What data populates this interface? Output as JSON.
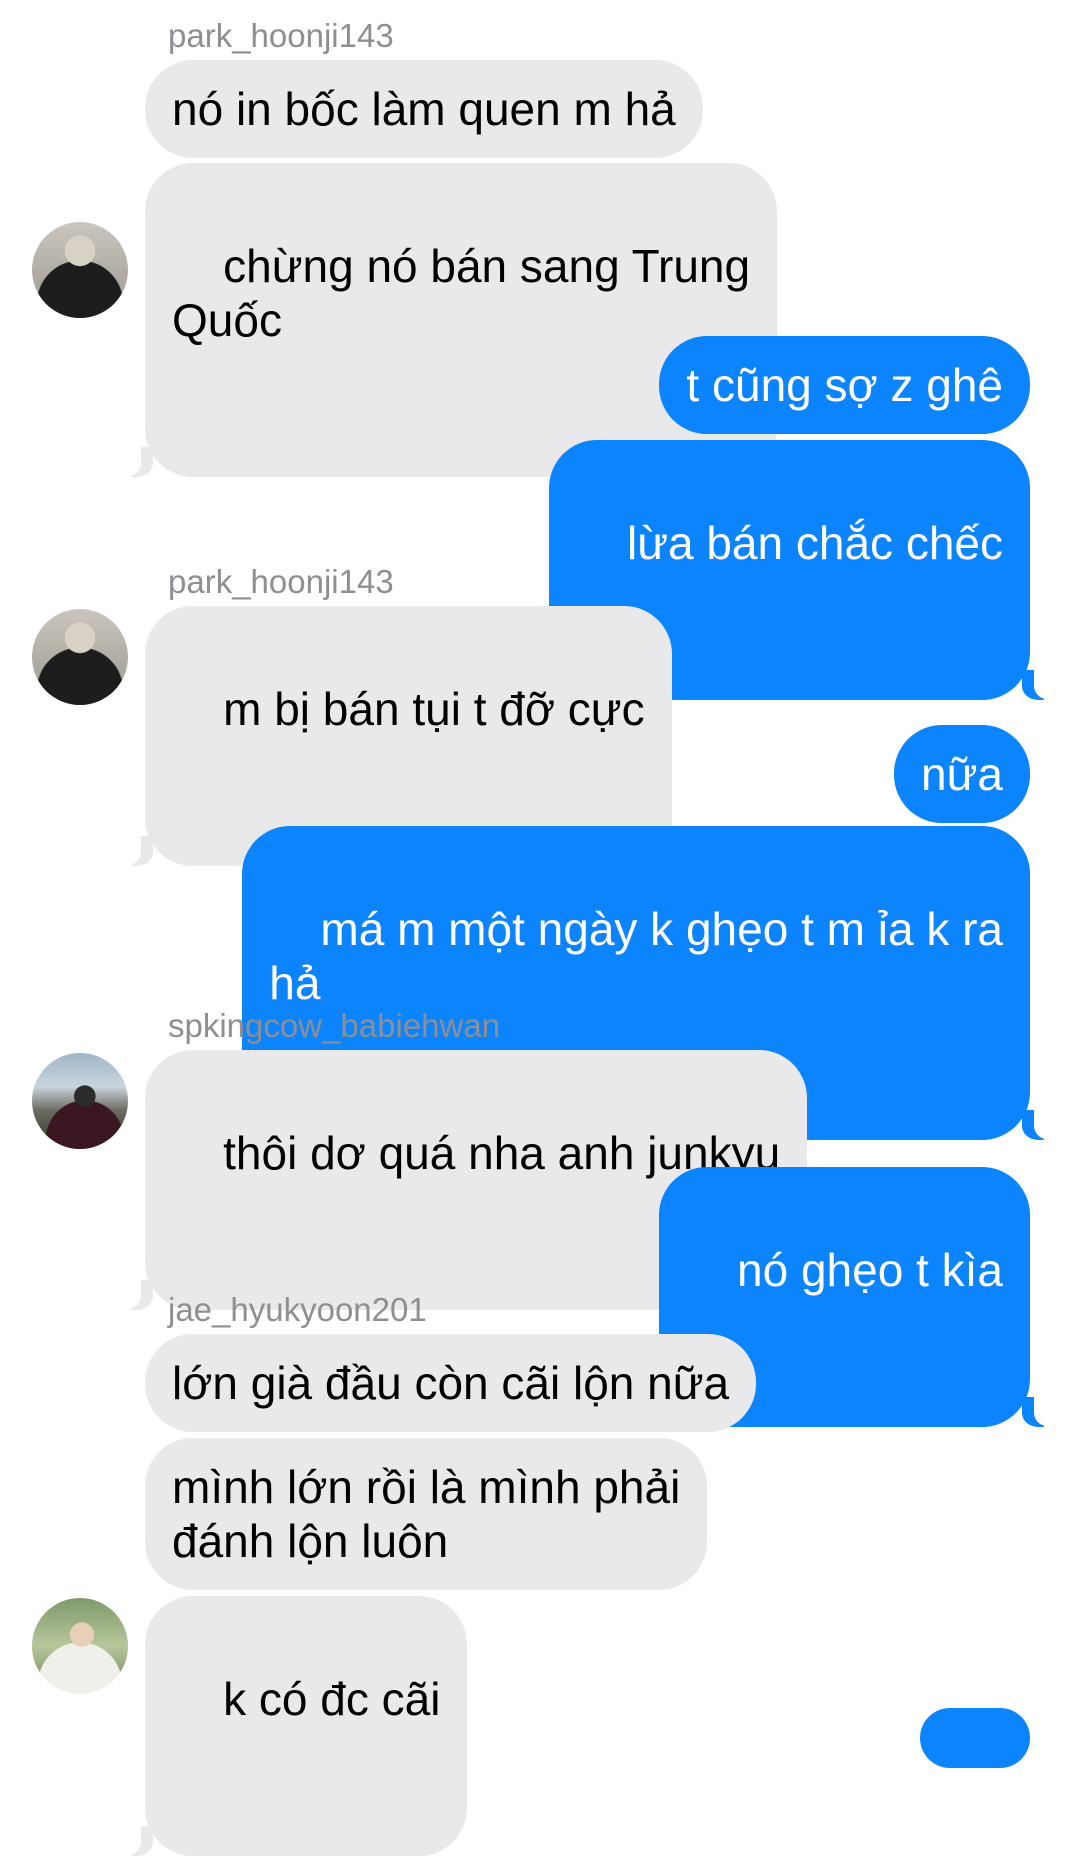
{
  "conversation": {
    "senders": {
      "s1": "park_hoonji143",
      "s2": "park_hoonji143",
      "s3": "spkingcow_babiehwan",
      "s4": "jae_hyukyoon201"
    },
    "messages": {
      "m1": "nó in bốc làm quen m hả",
      "m2": "chừng nó bán sang Trung\nQuốc",
      "m3": "t cũng sợ z ghê",
      "m4": "lừa bán chắc chếc",
      "m5": "m bị bán tụi t đỡ cực",
      "m6": "nữa",
      "m7": "má m một ngày k ghẹo t m ỉa k ra\nhả",
      "m8": "thôi dơ quá nha anh junkyu",
      "m9": "nó ghẹo t kìa",
      "m10": "lớn già đầu còn cãi lộn nữa",
      "m11": "mình lớn rồi là mình phải\nđánh lộn luôn",
      "m12": "k có đc cãi"
    }
  },
  "colors": {
    "incoming_bubble": "#e9e9eb",
    "outgoing_bubble": "#0b84fe",
    "sender_name": "#8e8e93"
  },
  "icons": [
    "avatar-park-hoonji143",
    "avatar-spkingcow-babiehwan",
    "avatar-jae-hyukyoon201"
  ]
}
